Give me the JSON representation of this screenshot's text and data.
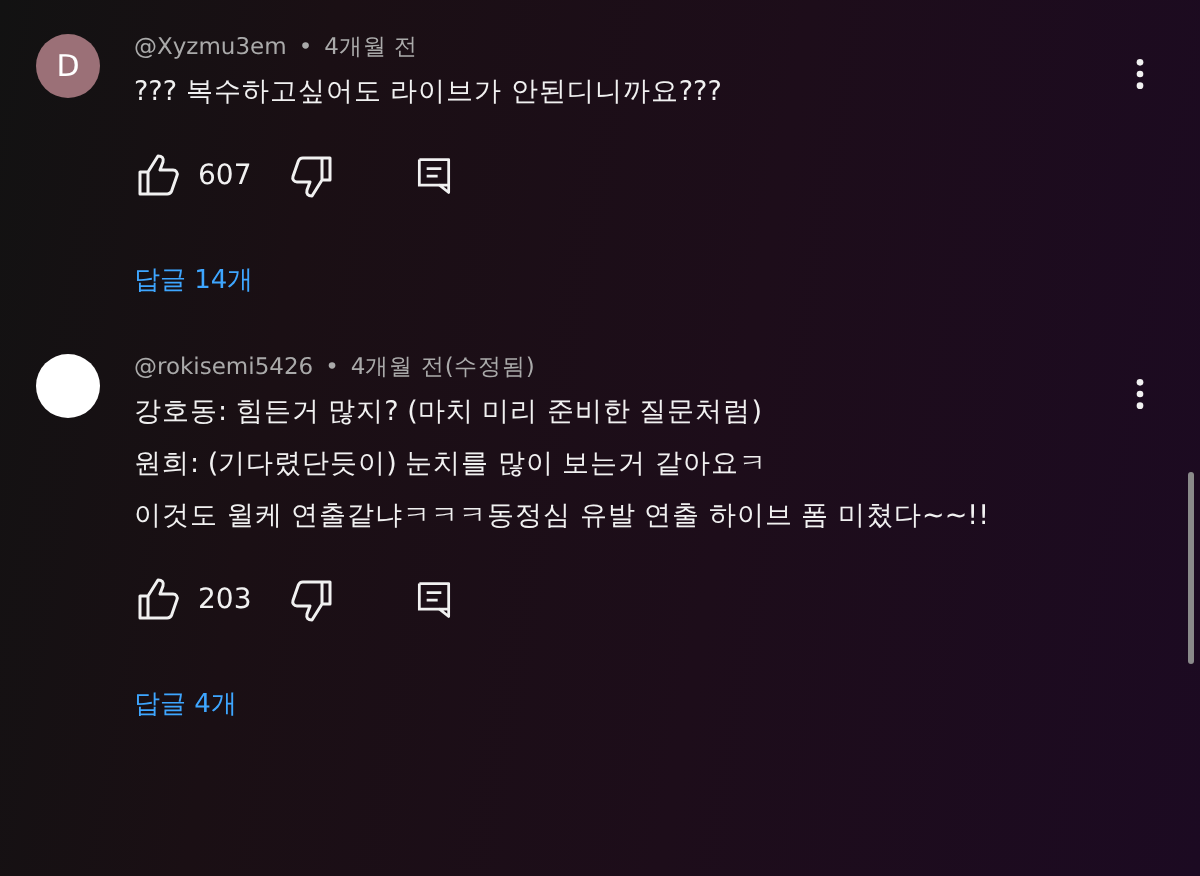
{
  "comments": [
    {
      "avatar": {
        "letter": "D",
        "color": "#9b7077"
      },
      "author": "@Xyzmu3em",
      "separator": "•",
      "time": "4개월 전",
      "lines": [
        "??? 복수하고싶어도 라이브가 안된디니까요???"
      ],
      "likes": "607",
      "replies": "답글 14개"
    },
    {
      "avatar": {
        "color": "#ffffff"
      },
      "author": "@rokisemi5426",
      "separator": "•",
      "time": "4개월 전(수정됨)",
      "lines": [
        "강호동: 힘든거 많지? (마치 미리 준비한 질문처럼)",
        "원희: (기다렸단듯이) 눈치를 많이 보는거 같아요ㅋ",
        "이것도 윌케 연출같냐ㅋㅋㅋ동정심 유발 연출 하이브 폼 미쳤다~~!!"
      ],
      "likes": "203",
      "replies": "답글 4개"
    }
  ]
}
